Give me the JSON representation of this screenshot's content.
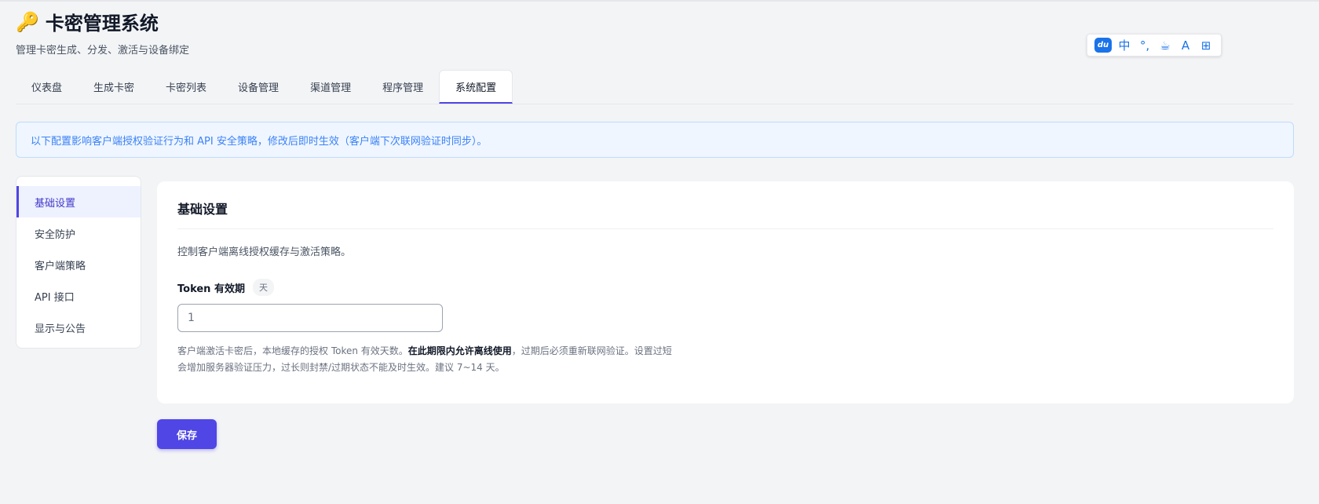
{
  "header": {
    "icon": "key-icon",
    "title": "卡密管理系统",
    "subtitle": "管理卡密生成、分发、激活与设备绑定"
  },
  "ime_bar": {
    "du": "du",
    "lang": "中",
    "punct": "°,",
    "cup": "☕",
    "skin": "A",
    "grid": "⊞"
  },
  "tabs": [
    {
      "label": "仪表盘"
    },
    {
      "label": "生成卡密"
    },
    {
      "label": "卡密列表"
    },
    {
      "label": "设备管理"
    },
    {
      "label": "渠道管理"
    },
    {
      "label": "程序管理"
    },
    {
      "label": "系统配置",
      "active": true
    }
  ],
  "notice": "以下配置影响客户端授权验证行为和 API 安全策略，修改后即时生效（客户端下次联网验证时同步）。",
  "sidenav": [
    {
      "label": "基础设置",
      "active": true
    },
    {
      "label": "安全防护"
    },
    {
      "label": "客户端策略"
    },
    {
      "label": "API 接口"
    },
    {
      "label": "显示与公告"
    }
  ],
  "card": {
    "title": "基础设置",
    "desc": "控制客户端离线授权缓存与激活策略。",
    "field": {
      "label": "Token 有效期",
      "unit": "天",
      "value": "1"
    },
    "help_pre": "客户端激活卡密后，本地缓存的授权 Token 有效天数。",
    "help_bold": "在此期限内允许离线使用",
    "help_post": "，过期后必须重新联网验证。设置过短会增加服务器验证压力，过长则封禁/过期状态不能及时生效。建议 7~14 天。"
  },
  "save_label": "保存",
  "colors": {
    "accent": "#4f46e5",
    "notice_text": "#3b82f6",
    "notice_bg": "#eff6ff"
  }
}
